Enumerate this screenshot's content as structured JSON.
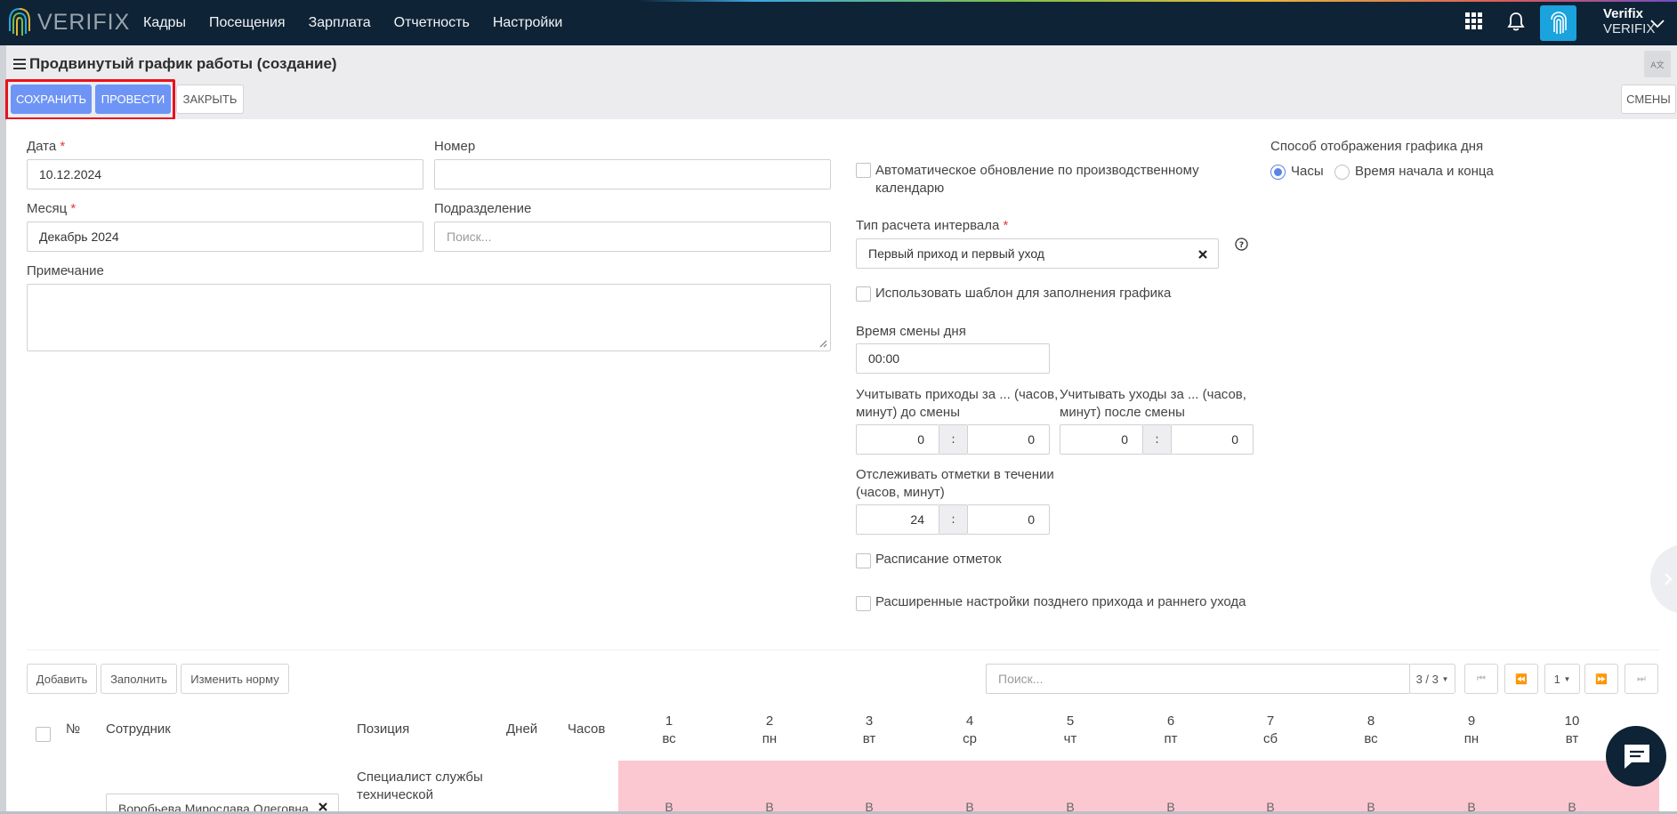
{
  "app": {
    "logo_text": "VERIFIX"
  },
  "nav": [
    "Кадры",
    "Посещения",
    "Зарплата",
    "Отчетность",
    "Настройки"
  ],
  "user": {
    "name": "Verifix",
    "company": "VERIFIX"
  },
  "page": {
    "title": "Продвинутый график работы (создание)"
  },
  "toolbar": {
    "save": "СОХРАНИТЬ",
    "post": "ПРОВЕСТИ",
    "close": "ЗАКРЫТЬ",
    "shifts": "СМЕНЫ"
  },
  "form": {
    "date_label": "Дата",
    "date_value": "10.12.2024",
    "number_label": "Номер",
    "number_value": "",
    "month_label": "Месяц",
    "month_value": "Декабрь 2024",
    "division_label": "Подразделение",
    "division_placeholder": "Поиск...",
    "note_label": "Примечание",
    "required_mark": "*",
    "auto_update_line1": "Автоматическое обновление по производственному",
    "auto_update_line2": "календарю",
    "interval_type_label": "Тип расчета интервала",
    "interval_type_value": "Первый приход и первый уход",
    "use_template": "Использовать шаблон для заполнения графика",
    "shift_time_label": "Время смены дня",
    "shift_time_value": "00:00",
    "arrivals_label_line1": "Учитывать приходы за ... (часов,",
    "arrivals_label_line2": "минут) до смены",
    "arrivals_hours": "0",
    "arrivals_minutes": "0",
    "departures_label_line1": "Учитывать уходы за ... (часов,",
    "departures_label_line2": "минут) после смены",
    "departures_hours": "0",
    "departures_minutes": "0",
    "track_label_line1": "Отслеживать отметки в течении",
    "track_label_line2": "(часов, минут)",
    "track_hours": "24",
    "track_minutes": "0",
    "colon": ":",
    "marks_schedule": "Расписание отметок",
    "advanced_late": "Расширенные настройки позднего прихода и раннего ухода",
    "display_mode_label": "Способ отображения графика дня",
    "display_mode_hours": "Часы",
    "display_mode_start_end": "Время начала и конца"
  },
  "table_toolbar": {
    "add": "Добавить",
    "fill": "Заполнить",
    "change_norm": "Изменить норму",
    "search_placeholder": "Поиск...",
    "count": "3 / 3",
    "page": "1"
  },
  "table": {
    "headers": {
      "num": "№",
      "employee": "Сотрудник",
      "position": "Позиция",
      "days": "Дней",
      "hours": "Часов"
    },
    "days": [
      {
        "d": "1",
        "w": "вс"
      },
      {
        "d": "2",
        "w": "пн"
      },
      {
        "d": "3",
        "w": "вт"
      },
      {
        "d": "4",
        "w": "ср"
      },
      {
        "d": "5",
        "w": "чт"
      },
      {
        "d": "6",
        "w": "пт"
      },
      {
        "d": "7",
        "w": "сб"
      },
      {
        "d": "8",
        "w": "вс"
      },
      {
        "d": "9",
        "w": "пн"
      },
      {
        "d": "10",
        "w": "вт"
      }
    ],
    "row": {
      "employee": "Воробьева Мирослава Олеговна",
      "position_line1": "Специалист службы",
      "position_line2": "технической",
      "day_value": "В"
    }
  }
}
